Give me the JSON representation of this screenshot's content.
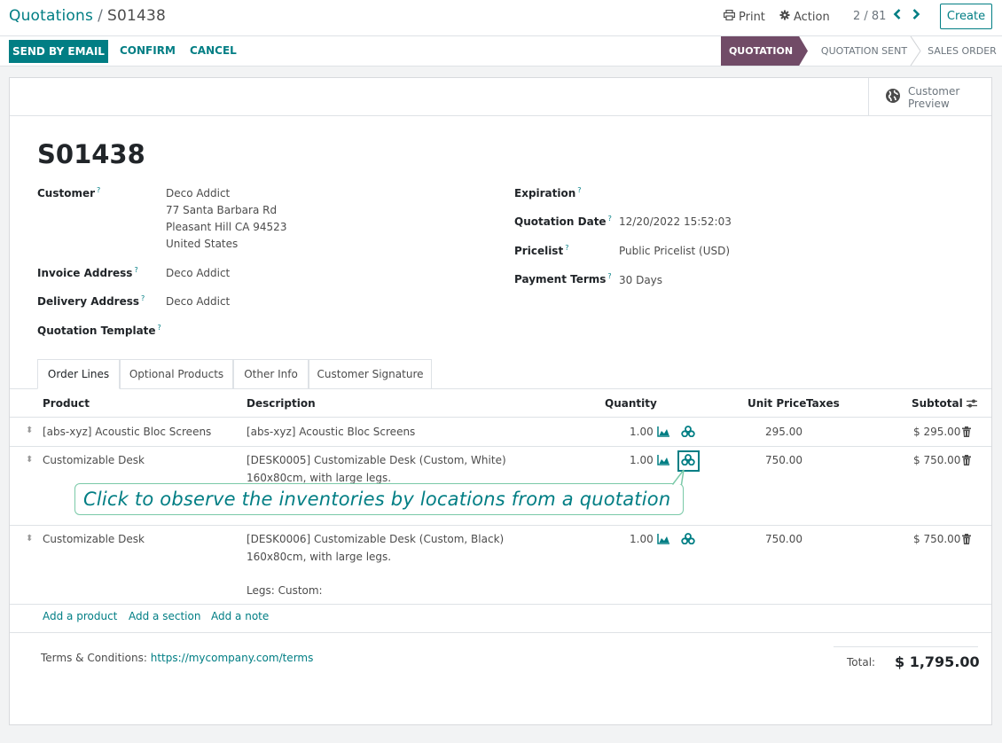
{
  "breadcrumb": {
    "parent": "Quotations",
    "separator": "/",
    "current": "S01438"
  },
  "toolbar": {
    "print": "Print",
    "action": "Action",
    "pager": "2 / 81",
    "create": "Create"
  },
  "statusbar": {
    "send_email": "SEND BY EMAIL",
    "confirm": "CONFIRM",
    "cancel": "CANCEL",
    "stages": [
      "QUOTATION",
      "QUOTATION SENT",
      "SALES ORDER"
    ],
    "active_stage": "QUOTATION"
  },
  "sheet": {
    "preview_line1": "Customer",
    "preview_line2": "Preview",
    "record_name": "S01438",
    "fields": {
      "customer_label": "Customer",
      "customer_name": "Deco Addict",
      "customer_addr1": "77 Santa Barbara Rd",
      "customer_addr2": "Pleasant Hill CA 94523",
      "customer_addr3": "United States",
      "invoice_label": "Invoice Address",
      "invoice_value": "Deco Addict",
      "delivery_label": "Delivery Address",
      "delivery_value": "Deco Addict",
      "template_label": "Quotation Template",
      "expiration_label": "Expiration",
      "qdate_label": "Quotation Date",
      "qdate_value": "12/20/2022 15:52:03",
      "pricelist_label": "Pricelist",
      "pricelist_value": "Public Pricelist (USD)",
      "terms_label": "Payment Terms",
      "terms_value": "30 Days",
      "help_mark": "?"
    },
    "tabs": [
      "Order Lines",
      "Optional Products",
      "Other Info",
      "Customer Signature"
    ],
    "table": {
      "headers": {
        "product": "Product",
        "description": "Description",
        "quantity": "Quantity",
        "unit_price": "Unit Price",
        "taxes": "Taxes",
        "subtotal": "Subtotal"
      },
      "rows": [
        {
          "product": "[abs-xyz] Acoustic Bloc Screens",
          "desc1": "[abs-xyz] Acoustic Bloc Screens",
          "desc2": "",
          "desc3": "",
          "qty": "1.00",
          "price": "295.00",
          "subtotal": "$ 295.00"
        },
        {
          "product": "Customizable Desk",
          "desc1": "[DESK0005] Customizable Desk (Custom, White)",
          "desc2": "160x80cm, with large legs.",
          "desc3": "",
          "qty": "1.00",
          "price": "750.00",
          "subtotal": "$ 750.00"
        },
        {
          "product": "Customizable Desk",
          "desc1": "[DESK0006] Customizable Desk (Custom, Black)",
          "desc2": "160x80cm, with large legs.",
          "desc3": "Legs: Custom:",
          "qty": "1.00",
          "price": "750.00",
          "subtotal": "$ 750.00"
        }
      ],
      "add_product": "Add a product",
      "add_section": "Add a section",
      "add_note": "Add a note"
    },
    "terms_text": "Terms & Conditions:",
    "terms_url": "https://mycompany.com/terms",
    "total_label": "Total:",
    "total_value": "$ 1,795.00"
  },
  "callout": {
    "text": "Click to observe the inventories by locations from a quotation"
  },
  "colors": {
    "brand": "#017e84",
    "stage_active": "#714b67",
    "callout_border": "#7ac9a8"
  },
  "icons": [
    "print-icon",
    "gear-icon",
    "chevron-left-icon",
    "chevron-right-icon",
    "globe-icon",
    "drag-handle-icon",
    "forecast-chart-icon",
    "inventory-locations-icon",
    "trash-icon",
    "column-settings-icon"
  ]
}
